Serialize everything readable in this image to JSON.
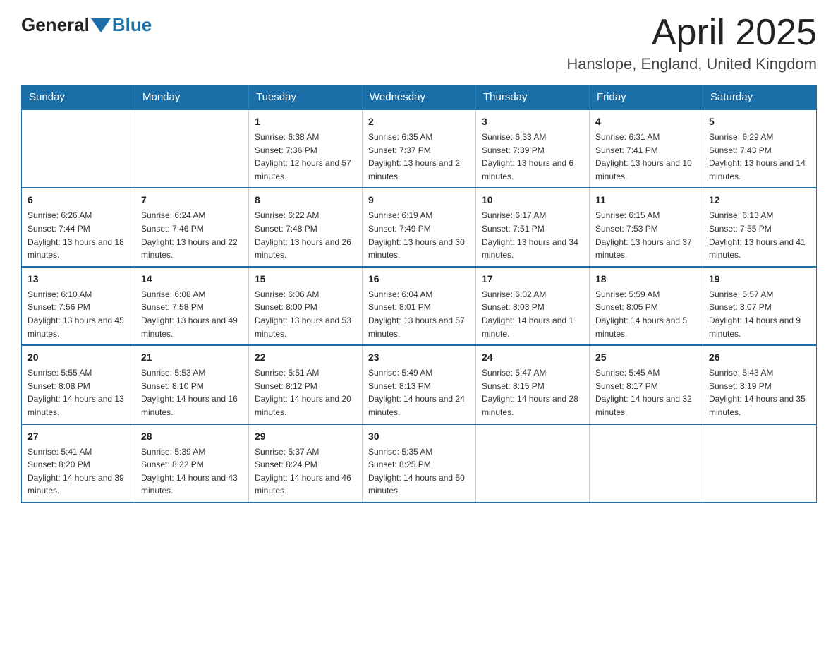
{
  "header": {
    "logo_general": "General",
    "logo_blue": "Blue",
    "month_year": "April 2025",
    "location": "Hanslope, England, United Kingdom"
  },
  "days_of_week": [
    "Sunday",
    "Monday",
    "Tuesday",
    "Wednesday",
    "Thursday",
    "Friday",
    "Saturday"
  ],
  "weeks": [
    [
      {
        "day": "",
        "sunrise": "",
        "sunset": "",
        "daylight": ""
      },
      {
        "day": "",
        "sunrise": "",
        "sunset": "",
        "daylight": ""
      },
      {
        "day": "1",
        "sunrise": "Sunrise: 6:38 AM",
        "sunset": "Sunset: 7:36 PM",
        "daylight": "Daylight: 12 hours and 57 minutes."
      },
      {
        "day": "2",
        "sunrise": "Sunrise: 6:35 AM",
        "sunset": "Sunset: 7:37 PM",
        "daylight": "Daylight: 13 hours and 2 minutes."
      },
      {
        "day": "3",
        "sunrise": "Sunrise: 6:33 AM",
        "sunset": "Sunset: 7:39 PM",
        "daylight": "Daylight: 13 hours and 6 minutes."
      },
      {
        "day": "4",
        "sunrise": "Sunrise: 6:31 AM",
        "sunset": "Sunset: 7:41 PM",
        "daylight": "Daylight: 13 hours and 10 minutes."
      },
      {
        "day": "5",
        "sunrise": "Sunrise: 6:29 AM",
        "sunset": "Sunset: 7:43 PM",
        "daylight": "Daylight: 13 hours and 14 minutes."
      }
    ],
    [
      {
        "day": "6",
        "sunrise": "Sunrise: 6:26 AM",
        "sunset": "Sunset: 7:44 PM",
        "daylight": "Daylight: 13 hours and 18 minutes."
      },
      {
        "day": "7",
        "sunrise": "Sunrise: 6:24 AM",
        "sunset": "Sunset: 7:46 PM",
        "daylight": "Daylight: 13 hours and 22 minutes."
      },
      {
        "day": "8",
        "sunrise": "Sunrise: 6:22 AM",
        "sunset": "Sunset: 7:48 PM",
        "daylight": "Daylight: 13 hours and 26 minutes."
      },
      {
        "day": "9",
        "sunrise": "Sunrise: 6:19 AM",
        "sunset": "Sunset: 7:49 PM",
        "daylight": "Daylight: 13 hours and 30 minutes."
      },
      {
        "day": "10",
        "sunrise": "Sunrise: 6:17 AM",
        "sunset": "Sunset: 7:51 PM",
        "daylight": "Daylight: 13 hours and 34 minutes."
      },
      {
        "day": "11",
        "sunrise": "Sunrise: 6:15 AM",
        "sunset": "Sunset: 7:53 PM",
        "daylight": "Daylight: 13 hours and 37 minutes."
      },
      {
        "day": "12",
        "sunrise": "Sunrise: 6:13 AM",
        "sunset": "Sunset: 7:55 PM",
        "daylight": "Daylight: 13 hours and 41 minutes."
      }
    ],
    [
      {
        "day": "13",
        "sunrise": "Sunrise: 6:10 AM",
        "sunset": "Sunset: 7:56 PM",
        "daylight": "Daylight: 13 hours and 45 minutes."
      },
      {
        "day": "14",
        "sunrise": "Sunrise: 6:08 AM",
        "sunset": "Sunset: 7:58 PM",
        "daylight": "Daylight: 13 hours and 49 minutes."
      },
      {
        "day": "15",
        "sunrise": "Sunrise: 6:06 AM",
        "sunset": "Sunset: 8:00 PM",
        "daylight": "Daylight: 13 hours and 53 minutes."
      },
      {
        "day": "16",
        "sunrise": "Sunrise: 6:04 AM",
        "sunset": "Sunset: 8:01 PM",
        "daylight": "Daylight: 13 hours and 57 minutes."
      },
      {
        "day": "17",
        "sunrise": "Sunrise: 6:02 AM",
        "sunset": "Sunset: 8:03 PM",
        "daylight": "Daylight: 14 hours and 1 minute."
      },
      {
        "day": "18",
        "sunrise": "Sunrise: 5:59 AM",
        "sunset": "Sunset: 8:05 PM",
        "daylight": "Daylight: 14 hours and 5 minutes."
      },
      {
        "day": "19",
        "sunrise": "Sunrise: 5:57 AM",
        "sunset": "Sunset: 8:07 PM",
        "daylight": "Daylight: 14 hours and 9 minutes."
      }
    ],
    [
      {
        "day": "20",
        "sunrise": "Sunrise: 5:55 AM",
        "sunset": "Sunset: 8:08 PM",
        "daylight": "Daylight: 14 hours and 13 minutes."
      },
      {
        "day": "21",
        "sunrise": "Sunrise: 5:53 AM",
        "sunset": "Sunset: 8:10 PM",
        "daylight": "Daylight: 14 hours and 16 minutes."
      },
      {
        "day": "22",
        "sunrise": "Sunrise: 5:51 AM",
        "sunset": "Sunset: 8:12 PM",
        "daylight": "Daylight: 14 hours and 20 minutes."
      },
      {
        "day": "23",
        "sunrise": "Sunrise: 5:49 AM",
        "sunset": "Sunset: 8:13 PM",
        "daylight": "Daylight: 14 hours and 24 minutes."
      },
      {
        "day": "24",
        "sunrise": "Sunrise: 5:47 AM",
        "sunset": "Sunset: 8:15 PM",
        "daylight": "Daylight: 14 hours and 28 minutes."
      },
      {
        "day": "25",
        "sunrise": "Sunrise: 5:45 AM",
        "sunset": "Sunset: 8:17 PM",
        "daylight": "Daylight: 14 hours and 32 minutes."
      },
      {
        "day": "26",
        "sunrise": "Sunrise: 5:43 AM",
        "sunset": "Sunset: 8:19 PM",
        "daylight": "Daylight: 14 hours and 35 minutes."
      }
    ],
    [
      {
        "day": "27",
        "sunrise": "Sunrise: 5:41 AM",
        "sunset": "Sunset: 8:20 PM",
        "daylight": "Daylight: 14 hours and 39 minutes."
      },
      {
        "day": "28",
        "sunrise": "Sunrise: 5:39 AM",
        "sunset": "Sunset: 8:22 PM",
        "daylight": "Daylight: 14 hours and 43 minutes."
      },
      {
        "day": "29",
        "sunrise": "Sunrise: 5:37 AM",
        "sunset": "Sunset: 8:24 PM",
        "daylight": "Daylight: 14 hours and 46 minutes."
      },
      {
        "day": "30",
        "sunrise": "Sunrise: 5:35 AM",
        "sunset": "Sunset: 8:25 PM",
        "daylight": "Daylight: 14 hours and 50 minutes."
      },
      {
        "day": "",
        "sunrise": "",
        "sunset": "",
        "daylight": ""
      },
      {
        "day": "",
        "sunrise": "",
        "sunset": "",
        "daylight": ""
      },
      {
        "day": "",
        "sunrise": "",
        "sunset": "",
        "daylight": ""
      }
    ]
  ]
}
